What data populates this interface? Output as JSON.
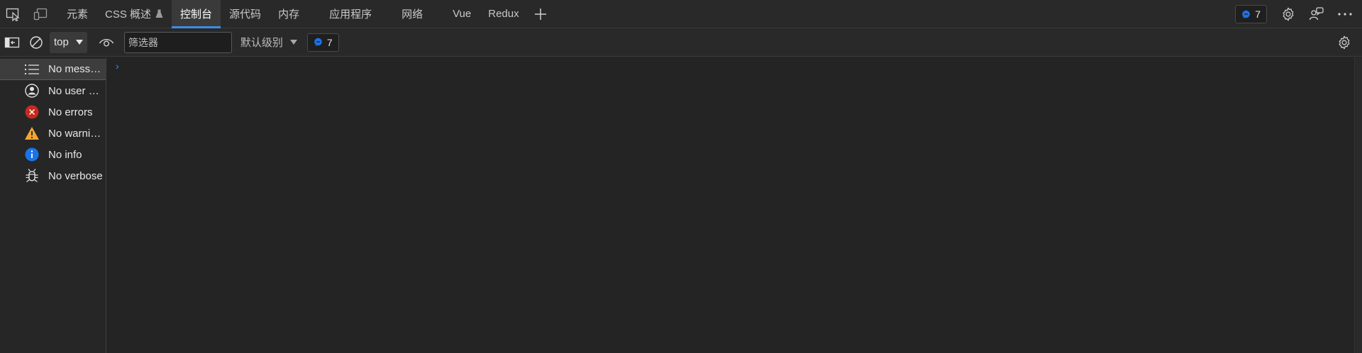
{
  "tabs": [
    {
      "label": "元素",
      "active": false
    },
    {
      "label": "CSS 概述",
      "active": false
    },
    {
      "label": "控制台",
      "active": true
    },
    {
      "label": "源代码",
      "active": false
    },
    {
      "label": "内存",
      "active": false
    },
    {
      "label": "应用程序",
      "active": false
    },
    {
      "label": "网络",
      "active": false
    },
    {
      "label": "Vue",
      "active": false
    },
    {
      "label": "Redux",
      "active": false
    }
  ],
  "issues_count": "7",
  "toolbar": {
    "context": "top",
    "filter_placeholder": "筛选器",
    "levels_label": "默认级别",
    "issues_count": "7"
  },
  "sidebar": {
    "items": [
      {
        "label": "No messages",
        "icon": "list-icon"
      },
      {
        "label": "No user messages",
        "icon": "user-icon"
      },
      {
        "label": "No errors",
        "icon": "error-icon"
      },
      {
        "label": "No warnings",
        "icon": "warning-icon"
      },
      {
        "label": "No info",
        "icon": "info-icon"
      },
      {
        "label": "No verbose",
        "icon": "bug-icon"
      }
    ]
  },
  "console": {
    "prompt": "›"
  },
  "colors": {
    "accent": "#3b8eea",
    "error": "#c42b1c",
    "warning": "#f2a633",
    "info": "#1b73e8",
    "background": "#242424"
  }
}
